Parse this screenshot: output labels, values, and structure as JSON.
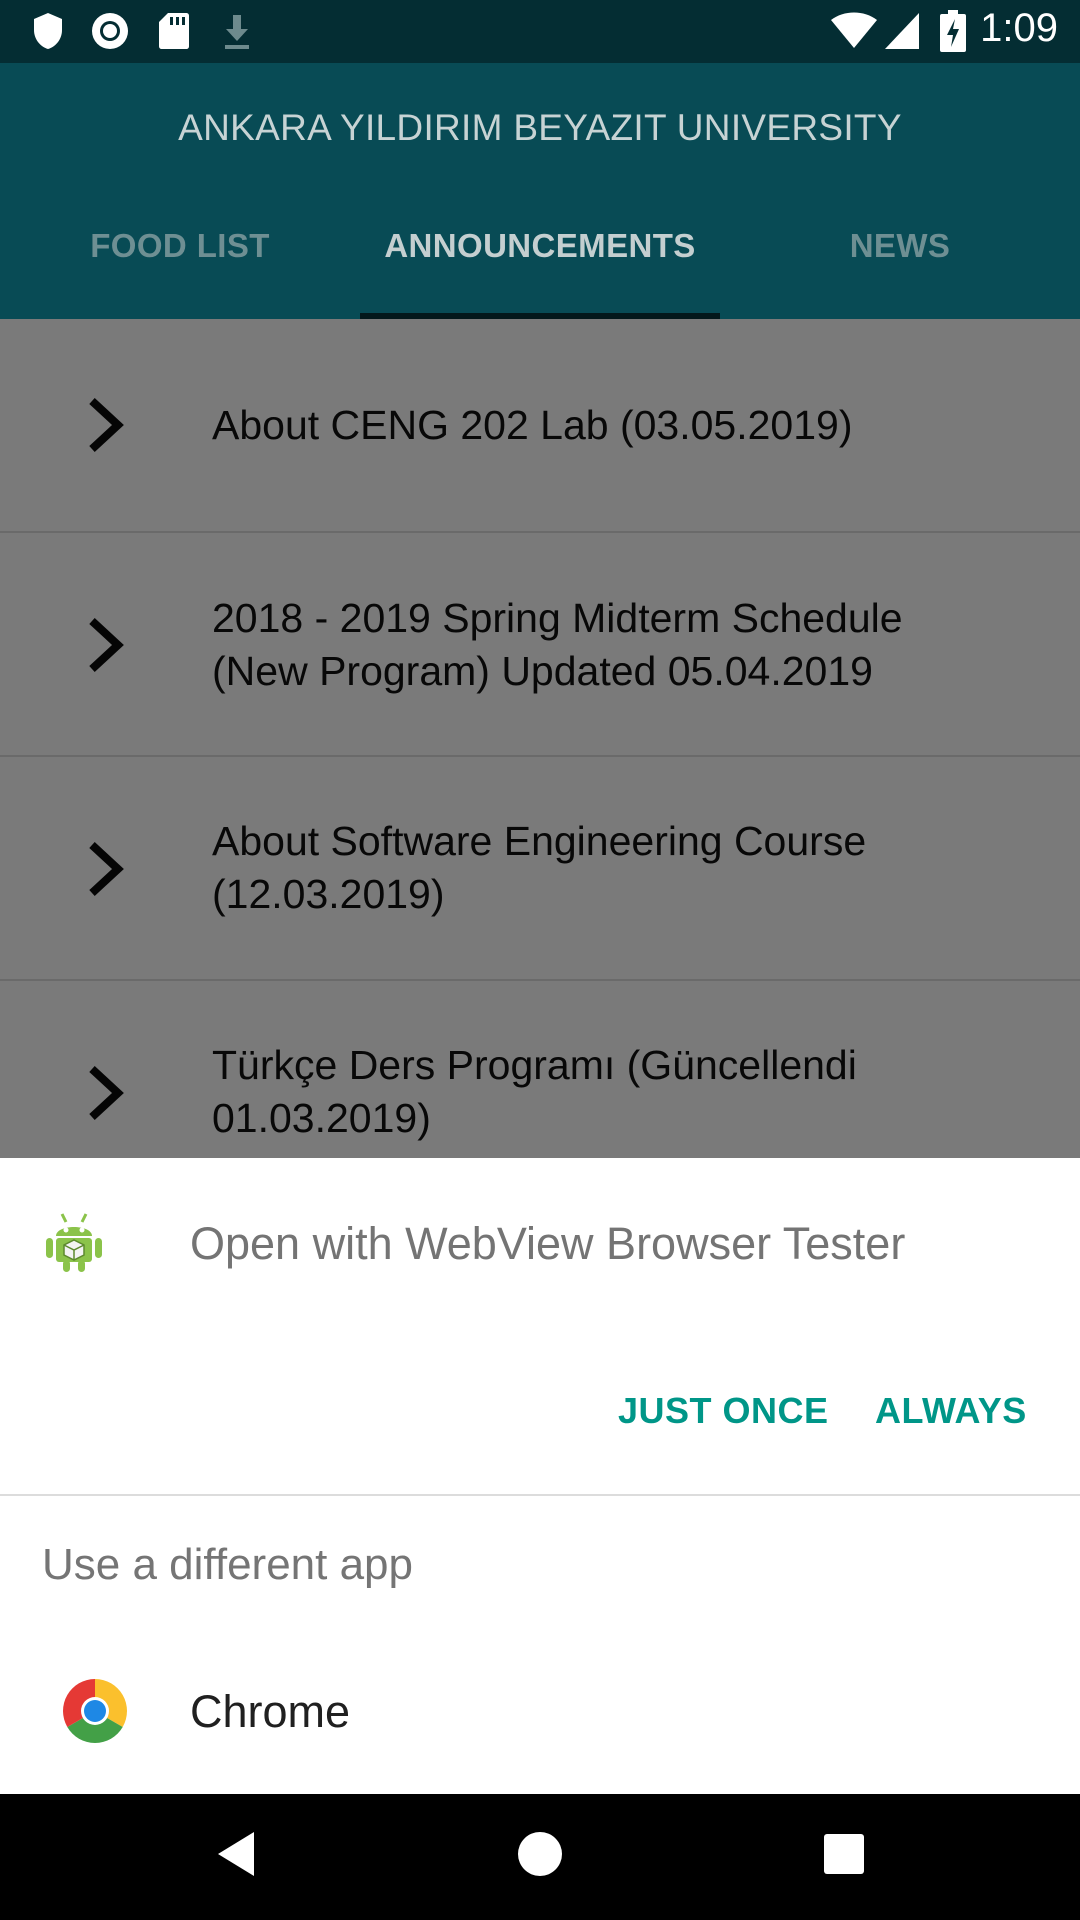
{
  "status_bar": {
    "time": "1:09",
    "left_icons": [
      "shield-icon",
      "record-icon",
      "sd-card-icon",
      "download-icon"
    ],
    "right_icons": [
      "wifi-icon",
      "signal-icon",
      "battery-charging-icon"
    ]
  },
  "app_bar": {
    "title": "ANKARA YILDIRIM BEYAZIT UNIVERSITY",
    "tabs": [
      {
        "label": "FOOD LIST",
        "selected": false
      },
      {
        "label": "ANNOUNCEMENTS",
        "selected": true
      },
      {
        "label": "NEWS",
        "selected": false
      }
    ]
  },
  "announcements": [
    {
      "lines": [
        "About CENG 202 Lab (03.05.2019)"
      ]
    },
    {
      "lines": [
        "2018 - 2019 Spring Midterm Schedule",
        "(New Program) Updated 05.04.2019"
      ]
    },
    {
      "lines": [
        "About Software Engineering Course",
        "(12.03.2019)"
      ]
    },
    {
      "lines": [
        "Türkçe Ders Programı (Güncellendi",
        "01.03.2019)"
      ]
    }
  ],
  "open_with_sheet": {
    "title": "Open with WebView Browser Tester",
    "app_icon": "android-icon",
    "just_once_label": "JUST ONCE",
    "always_label": "ALWAYS",
    "subtitle": "Use a different app",
    "apps": [
      {
        "label": "Chrome",
        "icon": "chrome-icon"
      }
    ]
  },
  "nav_bar": {
    "buttons": [
      "back-icon",
      "home-icon",
      "recents-icon"
    ]
  },
  "colors": {
    "status_bar": "#042d33",
    "app_bar": "#084b55",
    "accent": "#009688",
    "scrim_background": "#7a7a7a"
  }
}
